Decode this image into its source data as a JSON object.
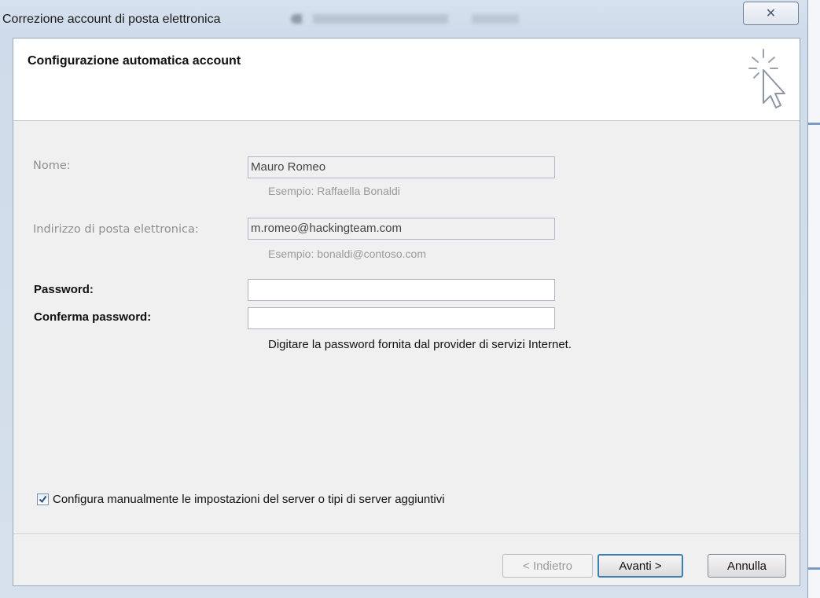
{
  "window": {
    "title": "Correzione account di posta elettronica",
    "close_glyph": "✕"
  },
  "header": {
    "title": "Configurazione automatica account",
    "icon": "wizard-cursor-icon"
  },
  "form": {
    "name_label": "Nome:",
    "name_value": "Mauro Romeo",
    "name_example": "Esempio: Raffaella Bonaldi",
    "email_label": "Indirizzo di posta elettronica:",
    "email_value": "m.romeo@hackingteam.com",
    "email_example": "Esempio: bonaldi@contoso.com",
    "password_label": "Password:",
    "password_value": "",
    "confirm_label": "Conferma password:",
    "confirm_value": "",
    "password_hint": "Digitare la password fornita dal provider di servizi Internet."
  },
  "manual": {
    "checked": true,
    "label": "Configura manualmente le impostazioni del server o tipi di server aggiuntivi"
  },
  "buttons": {
    "back": "< Indietro",
    "next": "Avanti >",
    "cancel": "Annulla"
  },
  "colors": {
    "accent": "#3c7fb1",
    "disabled_text": "#8f8f8f"
  }
}
